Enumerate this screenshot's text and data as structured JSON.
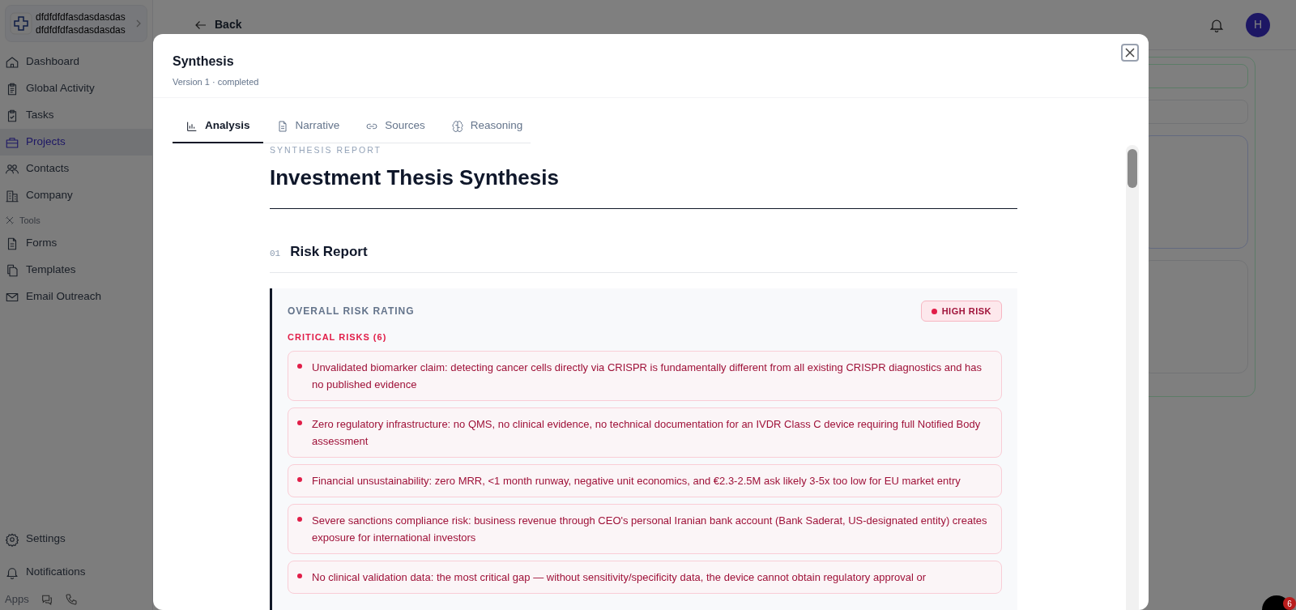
{
  "sidebar": {
    "brand": {
      "line_1": "dfdfdfdfasdasdasdas",
      "line_2": "dfdfdfdfasdasdasdas"
    },
    "items": [
      {
        "label": "Dashboard",
        "selected": false
      },
      {
        "label": "Global Activity",
        "selected": false
      },
      {
        "label": "Tasks",
        "selected": false
      },
      {
        "label": "Projects",
        "selected": true
      },
      {
        "label": "Contacts",
        "selected": false
      },
      {
        "label": "Company",
        "selected": false
      }
    ],
    "tools_label": "Tools",
    "tools": [
      {
        "label": "Forms",
        "selected": false
      },
      {
        "label": "Templates",
        "selected": false
      },
      {
        "label": "Email Outreach",
        "selected": false
      }
    ],
    "footer": [
      {
        "label": "Settings"
      },
      {
        "label": "Notifications"
      }
    ],
    "apps_label": "Apps"
  },
  "topbar": {
    "back": "Back",
    "avatar": "H"
  },
  "chat_badge": "6",
  "modal": {
    "title": "Synthesis",
    "subtitle": "Version 1 · completed",
    "tabs": [
      {
        "label": "Analysis",
        "selected": true
      },
      {
        "label": "Narrative",
        "selected": false
      },
      {
        "label": "Sources",
        "selected": false
      },
      {
        "label": "Reasoning",
        "selected": false
      }
    ],
    "report": {
      "eyebrow": "SYNTHESIS REPORT",
      "title": "Investment Thesis Synthesis",
      "section": {
        "number": "01",
        "title": "Risk Report"
      },
      "rating_label": "OVERALL RISK RATING",
      "rating": "HIGH RISK",
      "critical_label": "CRITICAL RISKS (6)",
      "risks": [
        "Unvalidated biomarker claim: detecting cancer cells directly via CRISPR is fundamentally different from all existing CRISPR diagnostics and has no published evidence",
        "Zero regulatory infrastructure: no QMS, no clinical evidence, no technical documentation for an IVDR Class C device requiring full Notified Body assessment",
        "Financial unsustainability: zero MRR, <1 month runway, negative unit economics, and €2.3-2.5M ask likely 3-5x too low for EU market entry",
        "Severe sanctions compliance risk: business revenue through CEO's personal Iranian bank account (Bank Saderat, US-designated entity) creates exposure for international investors",
        "No clinical validation data: the most critical gap — without sensitivity/specificity data, the device cannot obtain regulatory approval or"
      ]
    }
  }
}
